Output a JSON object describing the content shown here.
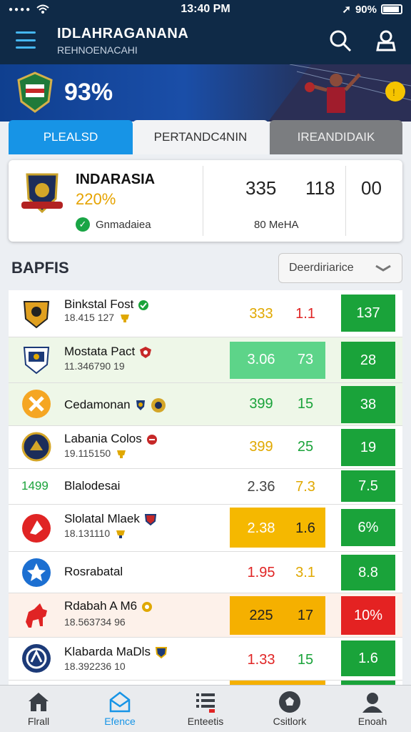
{
  "status_bar": {
    "time": "13:40 PM",
    "battery": "90%"
  },
  "app_bar": {
    "title": "IDLAHRAGANANA",
    "subtitle": "REHNOENACAHI"
  },
  "banner": {
    "percent": "93%"
  },
  "tabs": [
    {
      "label": "PLEALSD",
      "active": true
    },
    {
      "label": "PERTANDC4NIN",
      "active": false
    },
    {
      "label": "IREANDIDAIK",
      "active": false
    }
  ],
  "team_card": {
    "name": "INDARASIA",
    "percent": "220%",
    "status": "Gnmadaiea",
    "stat1": "335",
    "stat2": "118",
    "stat3": "00",
    "stat_label": "80 MeHA"
  },
  "section": {
    "title": "BAPFIS",
    "dropdown_label": "Deerdiriarice"
  },
  "rows": [
    {
      "name": "Binkstal Fost",
      "sub": "18.415 127",
      "v1": "333",
      "v2": "1.1",
      "v3": "137",
      "v1_color": "#e0a800",
      "v2_color": "#e02424",
      "v3_color": "#1aa33a",
      "hl_color": "",
      "row_bg": "#ffffff"
    },
    {
      "name": "Mostata Pact",
      "sub": "11.346790 19",
      "v1": "3.06",
      "v2": "73",
      "v3": "28",
      "v1_color": "#ffffff",
      "v2_color": "#ffffff",
      "v3_color": "#1aa33a",
      "hl_color": "#5dd489",
      "row_bg": "#eef7e8"
    },
    {
      "name": "Cedamonan",
      "sub": "",
      "v1": "399",
      "v2": "15",
      "v3": "38",
      "v1_color": "#1aa33a",
      "v2_color": "#1aa33a",
      "v3_color": "#1aa33a",
      "hl_color": "",
      "row_bg": "#eef7e8"
    },
    {
      "name": "Labania Colos",
      "sub": "19.115150",
      "v1": "399",
      "v2": "25",
      "v3": "19",
      "v1_color": "#e0a800",
      "v2_color": "#1aa33a",
      "v3_color": "#1aa33a",
      "hl_color": "",
      "row_bg": "#ffffff"
    },
    {
      "name": "Blalodesai",
      "sub": "",
      "prefix": "1499",
      "v1": "2.36",
      "v2": "7.3",
      "v3": "7.5",
      "v1_color": "#444444",
      "v2_color": "#e0a800",
      "v3_color": "#1aa33a",
      "hl_color": "",
      "row_bg": "#ffffff"
    },
    {
      "name": "Slolatal Mlaek",
      "sub": "18.131110",
      "v1": "2.38",
      "v2": "1.6",
      "v3": "6%",
      "v1_color": "#ffffff",
      "v2_color": "#222222",
      "v3_color": "#1aa33a",
      "hl_color": "#f5b800",
      "row_bg": "#ffffff"
    },
    {
      "name": "Rosrabatal",
      "sub": "",
      "v1": "1.95",
      "v2": "3.1",
      "v3": "8.8",
      "v1_color": "#e02424",
      "v2_color": "#e0a800",
      "v3_color": "#1aa33a",
      "hl_color": "",
      "row_bg": "#ffffff"
    },
    {
      "name": "Rdabah A M6",
      "sub": "18.563734 96",
      "v1": "225",
      "v2": "17",
      "v3": "10%",
      "v1_color": "#222222",
      "v2_color": "#222222",
      "v3_color": "#e42222",
      "hl_color": "#f5b000",
      "row_bg": "#fdf1ea"
    },
    {
      "name": "Klabarda MaDls",
      "sub": "18.392236 10",
      "v1": "1.33",
      "v2": "15",
      "v3": "1.6",
      "v1_color": "#e02424",
      "v2_color": "#1aa33a",
      "v3_color": "#1aa33a",
      "hl_color": "",
      "row_bg": "#ffffff"
    }
  ],
  "bottom_nav": [
    {
      "label": "Flrall",
      "icon": "home-icon",
      "active": false
    },
    {
      "label": "Efence",
      "icon": "envelope-icon",
      "active": true
    },
    {
      "label": "Enteetis",
      "icon": "list-icon",
      "active": false
    },
    {
      "label": "Csitlork",
      "icon": "ball-icon",
      "active": false
    },
    {
      "label": "Enoah",
      "icon": "user-icon",
      "active": false
    }
  ],
  "colors": {
    "accent": "#1794e6",
    "header": "#0f2a47",
    "green": "#1aa33a",
    "red": "#e42222",
    "yellow": "#f5b800"
  }
}
